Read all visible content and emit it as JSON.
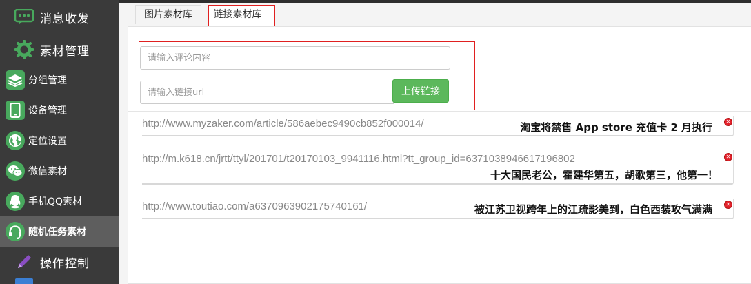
{
  "sidebar": {
    "items": [
      {
        "label": "消息收发",
        "icon": "chat-icon",
        "style": "big"
      },
      {
        "label": "素材管理",
        "icon": "gear-icon",
        "style": "big"
      },
      {
        "label": "分组管理",
        "icon": "layers-icon",
        "style": "small"
      },
      {
        "label": "设备管理",
        "icon": "phone-icon",
        "style": "small"
      },
      {
        "label": "定位设置",
        "icon": "globe-icon",
        "style": "small"
      },
      {
        "label": "微信素材",
        "icon": "wechat-icon",
        "style": "small"
      },
      {
        "label": "手机QQ素材",
        "icon": "qq-icon",
        "style": "small"
      },
      {
        "label": "随机任务素材",
        "icon": "headset-icon",
        "style": "small",
        "active": true
      },
      {
        "label": "操作控制",
        "icon": "pencil-icon",
        "style": "big"
      }
    ]
  },
  "tabs": [
    {
      "label": "图片素材库"
    },
    {
      "label": "链接素材库",
      "active": true
    }
  ],
  "form": {
    "comment_placeholder": "请输入评论内容",
    "url_placeholder": "请输入链接url",
    "upload_label": "上传链接"
  },
  "links": [
    {
      "url": "http://www.myzaker.com/article/586aebec9490cb852f000014/",
      "title": "淘宝将禁售 App store 充值卡 2 月执行"
    },
    {
      "url": "http://m.k618.cn/jrtt/ttyl/201701/t20170103_9941116.html?tt_group_id=6371038946617196802",
      "title": "十大国民老公，霍建华第五，胡歌第三，他第一！"
    },
    {
      "url": "http://www.toutiao.com/a6370963902175740161/",
      "title": "被江苏卫视跨年上的江疏影美到，白色西装攻气满满"
    }
  ],
  "colors": {
    "sidebar_bg": "#3a3a3a",
    "accent_green": "#48a95d",
    "button_green": "#5cb85c",
    "highlight_red": "#e02020",
    "delete_red": "#e3222c"
  }
}
